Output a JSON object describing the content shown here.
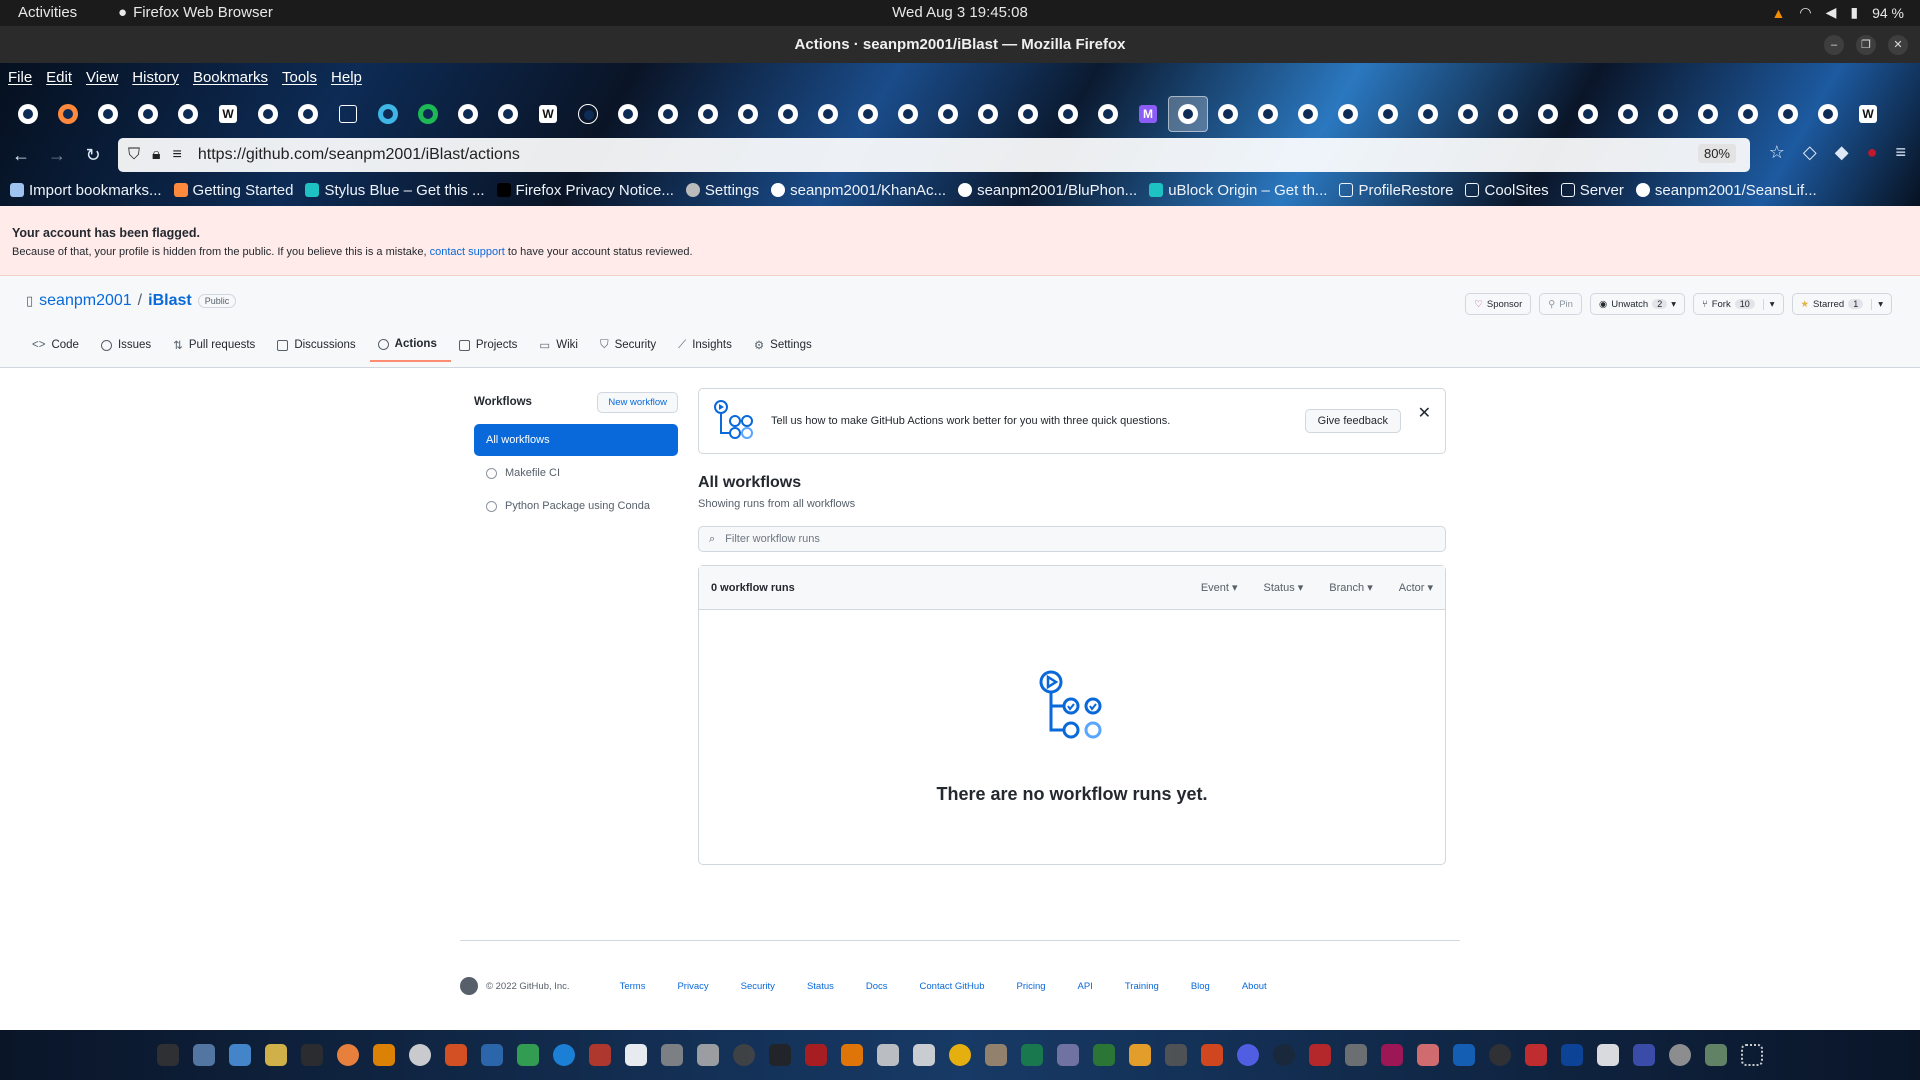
{
  "system": {
    "activities": "Activities",
    "app_name": "Firefox Web Browser",
    "clock": "Wed Aug 3  19:45:08",
    "battery": "94 %"
  },
  "window": {
    "title": "Actions · seanpm2001/iBlast — Mozilla Firefox"
  },
  "menubar": [
    "File",
    "Edit",
    "View",
    "History",
    "Bookmarks",
    "Tools",
    "Help"
  ],
  "urlbar": {
    "url": "https://github.com/seanpm2001/iBlast/actions",
    "zoom": "80%"
  },
  "bookmarks": [
    "Import bookmarks...",
    "Getting Started",
    "Stylus Blue – Get this ...",
    "Firefox Privacy Notice...",
    "Settings",
    "seanpm2001/KhanAc...",
    "seanpm2001/BluPhon...",
    "uBlock Origin – Get th...",
    "ProfileRestore",
    "CoolSites",
    "Server",
    "seanpm2001/SeansLif..."
  ],
  "flag_banner": {
    "title": "Your account has been flagged.",
    "text_before": "Because of that, your profile is hidden from the public. If you believe this is a mistake,",
    "link": "contact support",
    "text_after": "to have your account status reviewed."
  },
  "repo": {
    "owner": "seanpm2001",
    "separator": "/",
    "name": "iBlast",
    "visibility": "Public",
    "buttons": {
      "sponsor": "Sponsor",
      "pin": "Pin",
      "unwatch": "Unwatch",
      "unwatch_count": "2",
      "fork": "Fork",
      "fork_count": "10",
      "starred": "Starred",
      "star_count": "1"
    },
    "tabs": [
      "Code",
      "Issues",
      "Pull requests",
      "Discussions",
      "Actions",
      "Projects",
      "Wiki",
      "Security",
      "Insights",
      "Settings"
    ]
  },
  "sidebar": {
    "heading": "Workflows",
    "new_workflow": "New workflow",
    "items": [
      "All workflows",
      "Makefile CI",
      "Python Package using Conda"
    ]
  },
  "main": {
    "feedback_text": "Tell us how to make GitHub Actions work better for you with three quick questions.",
    "feedback_button": "Give feedback",
    "title": "All workflows",
    "subtitle": "Showing runs from all workflows",
    "filter_placeholder": "Filter workflow runs",
    "runs_count": "0 workflow runs",
    "filters": [
      "Event",
      "Status",
      "Branch",
      "Actor"
    ],
    "empty_message": "There are no workflow runs yet."
  },
  "footer": {
    "copyright": "© 2022 GitHub, Inc.",
    "links": [
      "Terms",
      "Privacy",
      "Security",
      "Status",
      "Docs",
      "Contact GitHub",
      "Pricing",
      "API",
      "Training",
      "Blog",
      "About"
    ]
  }
}
